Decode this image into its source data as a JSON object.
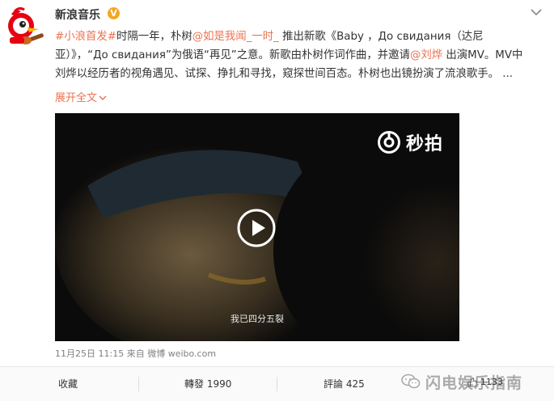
{
  "post": {
    "author": "新浪音乐",
    "verified_mark": "V",
    "text": {
      "topic": "#小浪首发#",
      "t1": "时隔一年，朴树",
      "mention1": "@如是我闻_一时_",
      "t2": " 推出新歌《Baby ，До свидания（达尼",
      "t3": "亚）》，“До свидания”为俄语“再见”之意。新歌由朴树作词作曲，并邀请",
      "mention2": "@刘烨",
      "t4": " 出演MV。MV中",
      "t5": "刘烨以经历者的视角遇见、试探、挣扎和寻找，窥探世间百态。朴树也出镜扮演了流浪歌手。 ..."
    },
    "expand_label": "展开全文",
    "video": {
      "watermark": "秒拍",
      "subtitle": "我已四分五裂"
    },
    "meta": {
      "time": "11月25日 11:15",
      "from": "來自",
      "source": "微博 weibo.com"
    }
  },
  "actions": {
    "favorite": "收藏",
    "repost": "轉發 1990",
    "comment": "評論 425",
    "like_count": "1133"
  },
  "watermark_wechat": "闪电娱乐指南",
  "colors": {
    "accent": "#eb7350",
    "verified": "#f5a623",
    "text": "#333333",
    "muted": "#808080"
  }
}
